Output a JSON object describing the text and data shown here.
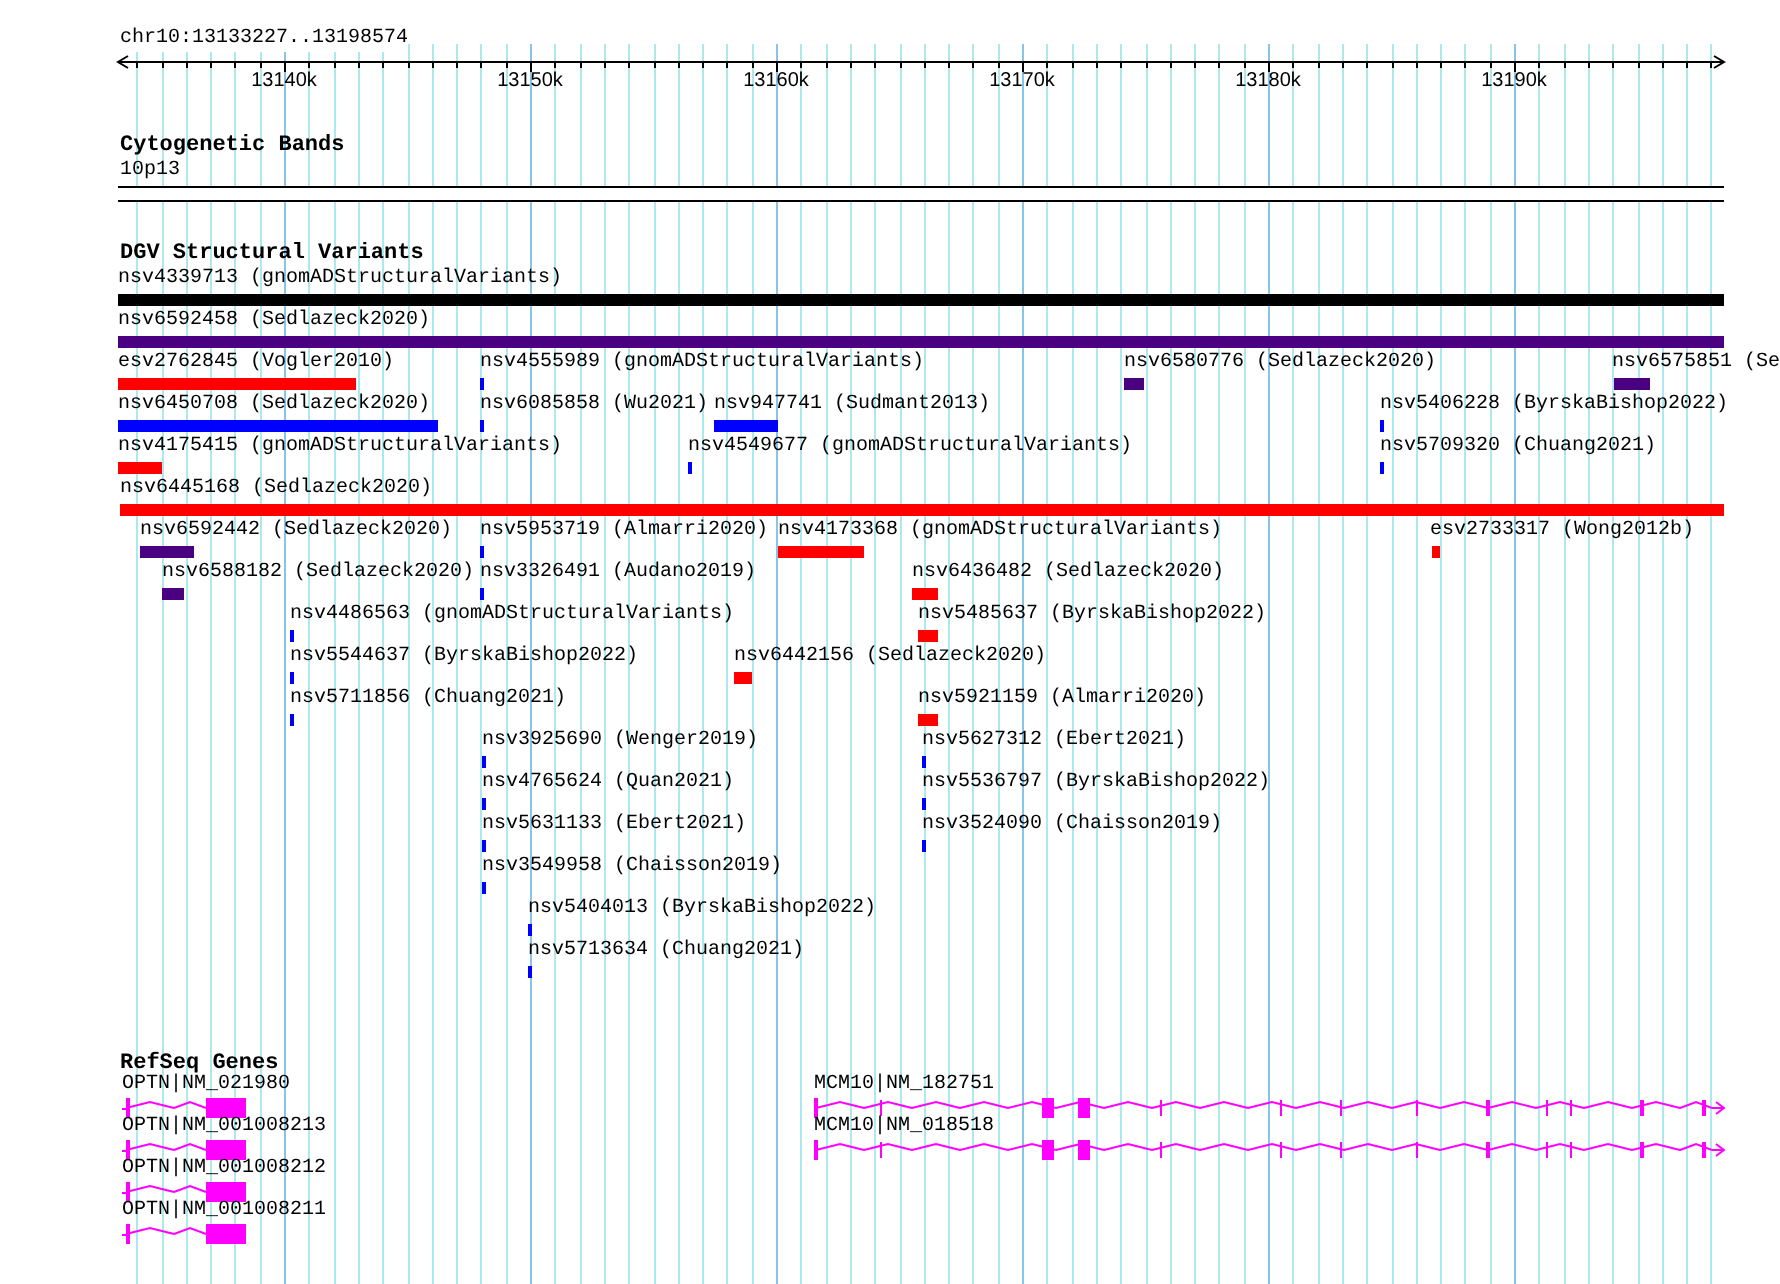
{
  "ruler": {
    "region": "chr10:13133227..13198574",
    "ticks": [
      "13140k",
      "13150k",
      "13160k",
      "13170k",
      "13180k",
      "13190k"
    ]
  },
  "cytogenetic_bands": {
    "title": "Cytogenetic Bands",
    "band": "10p13"
  },
  "dgv": {
    "title": "DGV Structural Variants",
    "variants": [
      {
        "label": "nsv4339713 (gnomADStructuralVariants)",
        "color": "#000000"
      },
      {
        "label": "nsv6592458 (Sedlazeck2020)",
        "color": "#4b0082"
      },
      {
        "label": "esv2762845 (Vogler2010)",
        "color": "#ff0000"
      },
      {
        "label": "nsv4555989 (gnomADStructuralVariants)",
        "color": "#0000ff"
      },
      {
        "label": "nsv6580776 (Sedlazeck2020)",
        "color": "#4b0082"
      },
      {
        "label": "nsv6575851 (Se",
        "color": "#4b0082"
      },
      {
        "label": "nsv6450708 (Sedlazeck2020)",
        "color": "#0000ff"
      },
      {
        "label": "nsv6085858 (Wu2021)",
        "color": "#0000ff"
      },
      {
        "label": "nsv947741 (Sudmant2013)",
        "color": "#0000ff"
      },
      {
        "label": "nsv5406228 (ByrskaBishop2022)",
        "color": "#0000ff"
      },
      {
        "label": "nsv4175415 (gnomADStructuralVariants)",
        "color": "#ff0000"
      },
      {
        "label": "nsv4549677 (gnomADStructuralVariants)",
        "color": "#0000ff"
      },
      {
        "label": "nsv5709320 (Chuang2021)",
        "color": "#0000ff"
      },
      {
        "label": "nsv6445168 (Sedlazeck2020)",
        "color": "#ff0000"
      },
      {
        "label": "nsv6592442 (Sedlazeck2020)",
        "color": "#4b0082"
      },
      {
        "label": "nsv5953719 (Almarri2020)",
        "color": "#0000ff"
      },
      {
        "label": "nsv4173368 (gnomADStructuralVariants)",
        "color": "#ff0000"
      },
      {
        "label": "esv2733317 (Wong2012b)",
        "color": "#ff0000"
      },
      {
        "label": "nsv6588182 (Sedlazeck2020)",
        "color": "#4b0082"
      },
      {
        "label": "nsv3326491 (Audano2019)",
        "color": "#0000ff"
      },
      {
        "label": "nsv6436482 (Sedlazeck2020)",
        "color": "#ff0000"
      },
      {
        "label": "nsv4486563 (gnomADStructuralVariants)",
        "color": "#0000ff"
      },
      {
        "label": "nsv5485637 (ByrskaBishop2022)",
        "color": "#ff0000"
      },
      {
        "label": "nsv5544637 (ByrskaBishop2022)",
        "color": "#0000ff"
      },
      {
        "label": "nsv6442156 (Sedlazeck2020)",
        "color": "#ff0000"
      },
      {
        "label": "nsv5711856 (Chuang2021)",
        "color": "#0000ff"
      },
      {
        "label": "nsv5921159 (Almarri2020)",
        "color": "#ff0000"
      },
      {
        "label": "nsv3925690 (Wenger2019)",
        "color": "#0000ff"
      },
      {
        "label": "nsv5627312 (Ebert2021)",
        "color": "#0000ff"
      },
      {
        "label": "nsv4765624 (Quan2021)",
        "color": "#0000ff"
      },
      {
        "label": "nsv5536797 (ByrskaBishop2022)",
        "color": "#0000ff"
      },
      {
        "label": "nsv5631133 (Ebert2021)",
        "color": "#0000ff"
      },
      {
        "label": "nsv3524090 (Chaisson2019)",
        "color": "#0000ff"
      },
      {
        "label": "nsv3549958 (Chaisson2019)",
        "color": "#0000ff"
      },
      {
        "label": "nsv5404013 (ByrskaBishop2022)",
        "color": "#0000ff"
      },
      {
        "label": "nsv5713634 (Chuang2021)",
        "color": "#0000ff"
      }
    ]
  },
  "refseq_genes": {
    "title": "RefSeq Genes",
    "genes": [
      {
        "label": "OPTN|NM_021980"
      },
      {
        "label": "MCM10|NM_182751"
      },
      {
        "label": "OPTN|NM_001008213"
      },
      {
        "label": "MCM10|NM_018518"
      },
      {
        "label": "OPTN|NM_001008212"
      },
      {
        "label": "OPTN|NM_001008211"
      }
    ]
  }
}
